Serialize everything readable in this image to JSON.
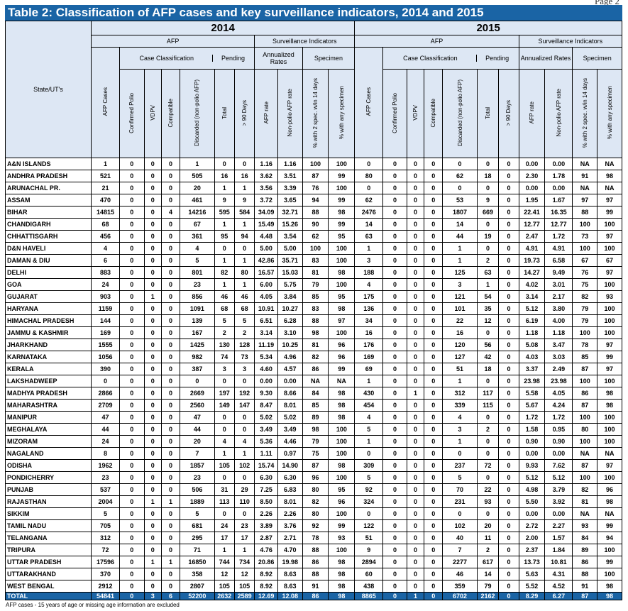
{
  "page_label": "Page 2",
  "title": "Table 2: Classification of AFP cases and key surveillance indicators, 2014 and 2015",
  "headers": {
    "state": "State/UT's",
    "years": [
      "2014",
      "2015"
    ],
    "afp": "AFP",
    "surveillance": "Surveillance Indicators",
    "case_classification": "Case Classification",
    "pending": "Pending",
    "annualized_rates": "Annualized Rates",
    "specimen": "Specimen",
    "afp_cases": "AFP Cases",
    "confirmed_polio": "Confirmed Polio",
    "vdpv": "VDPV",
    "compatible": "Compatible",
    "discarded": "Discarded (non-polio AFP)",
    "total": "Total",
    "days90": "> 90 Days",
    "afp_rate": "AFP rate",
    "non_polio_rate": "Non-polio AFP rate",
    "pct_2spec": "% with 2 spec. w/in 14 days",
    "pct_any": "% with any specimen"
  },
  "rows": [
    [
      "A&N ISLANDS",
      "1",
      "0",
      "0",
      "0",
      "1",
      "0",
      "0",
      "1.16",
      "1.16",
      "100",
      "100",
      "0",
      "0",
      "0",
      "0",
      "0",
      "0",
      "0",
      "0.00",
      "0.00",
      "NA",
      "NA"
    ],
    [
      "ANDHRA PRADESH",
      "521",
      "0",
      "0",
      "0",
      "505",
      "16",
      "16",
      "3.62",
      "3.51",
      "87",
      "99",
      "80",
      "0",
      "0",
      "0",
      "62",
      "18",
      "0",
      "2.30",
      "1.78",
      "91",
      "98"
    ],
    [
      "ARUNACHAL PR.",
      "21",
      "0",
      "0",
      "0",
      "20",
      "1",
      "1",
      "3.56",
      "3.39",
      "76",
      "100",
      "0",
      "0",
      "0",
      "0",
      "0",
      "0",
      "0",
      "0.00",
      "0.00",
      "NA",
      "NA"
    ],
    [
      "ASSAM",
      "470",
      "0",
      "0",
      "0",
      "461",
      "9",
      "9",
      "3.72",
      "3.65",
      "94",
      "99",
      "62",
      "0",
      "0",
      "0",
      "53",
      "9",
      "0",
      "1.95",
      "1.67",
      "97",
      "97"
    ],
    [
      "BIHAR",
      "14815",
      "0",
      "0",
      "4",
      "14216",
      "595",
      "584",
      "34.09",
      "32.71",
      "88",
      "98",
      "2476",
      "0",
      "0",
      "0",
      "1807",
      "669",
      "0",
      "22.41",
      "16.35",
      "88",
      "99"
    ],
    [
      "CHANDIGARH",
      "68",
      "0",
      "0",
      "0",
      "67",
      "1",
      "1",
      "15.49",
      "15.26",
      "90",
      "99",
      "14",
      "0",
      "0",
      "0",
      "14",
      "0",
      "0",
      "12.77",
      "12.77",
      "100",
      "100"
    ],
    [
      "CHHATTISGARH",
      "456",
      "0",
      "0",
      "0",
      "361",
      "95",
      "94",
      "4.48",
      "3.54",
      "62",
      "95",
      "63",
      "0",
      "0",
      "0",
      "44",
      "19",
      "0",
      "2.47",
      "1.72",
      "73",
      "97"
    ],
    [
      "D&N HAVELI",
      "4",
      "0",
      "0",
      "0",
      "4",
      "0",
      "0",
      "5.00",
      "5.00",
      "100",
      "100",
      "1",
      "0",
      "0",
      "0",
      "1",
      "0",
      "0",
      "4.91",
      "4.91",
      "100",
      "100"
    ],
    [
      "DAMAN & DIU",
      "6",
      "0",
      "0",
      "0",
      "5",
      "1",
      "1",
      "42.86",
      "35.71",
      "83",
      "100",
      "3",
      "0",
      "0",
      "0",
      "1",
      "2",
      "0",
      "19.73",
      "6.58",
      "67",
      "67"
    ],
    [
      "DELHI",
      "883",
      "0",
      "0",
      "0",
      "801",
      "82",
      "80",
      "16.57",
      "15.03",
      "81",
      "98",
      "188",
      "0",
      "0",
      "0",
      "125",
      "63",
      "0",
      "14.27",
      "9.49",
      "76",
      "97"
    ],
    [
      "GOA",
      "24",
      "0",
      "0",
      "0",
      "23",
      "1",
      "1",
      "6.00",
      "5.75",
      "79",
      "100",
      "4",
      "0",
      "0",
      "0",
      "3",
      "1",
      "0",
      "4.02",
      "3.01",
      "75",
      "100"
    ],
    [
      "GUJARAT",
      "903",
      "0",
      "1",
      "0",
      "856",
      "46",
      "46",
      "4.05",
      "3.84",
      "85",
      "95",
      "175",
      "0",
      "0",
      "0",
      "121",
      "54",
      "0",
      "3.14",
      "2.17",
      "82",
      "93"
    ],
    [
      "HARYANA",
      "1159",
      "0",
      "0",
      "0",
      "1091",
      "68",
      "68",
      "10.91",
      "10.27",
      "83",
      "98",
      "136",
      "0",
      "0",
      "0",
      "101",
      "35",
      "0",
      "5.12",
      "3.80",
      "79",
      "100"
    ],
    [
      "HIMACHAL PRADESH",
      "144",
      "0",
      "0",
      "0",
      "139",
      "5",
      "5",
      "6.51",
      "6.28",
      "88",
      "97",
      "34",
      "0",
      "0",
      "0",
      "22",
      "12",
      "0",
      "6.19",
      "4.00",
      "79",
      "100"
    ],
    [
      "JAMMU & KASHMIR",
      "169",
      "0",
      "0",
      "0",
      "167",
      "2",
      "2",
      "3.14",
      "3.10",
      "98",
      "100",
      "16",
      "0",
      "0",
      "0",
      "16",
      "0",
      "0",
      "1.18",
      "1.18",
      "100",
      "100"
    ],
    [
      "JHARKHAND",
      "1555",
      "0",
      "0",
      "0",
      "1425",
      "130",
      "128",
      "11.19",
      "10.25",
      "81",
      "96",
      "176",
      "0",
      "0",
      "0",
      "120",
      "56",
      "0",
      "5.08",
      "3.47",
      "78",
      "97"
    ],
    [
      "KARNATAKA",
      "1056",
      "0",
      "0",
      "0",
      "982",
      "74",
      "73",
      "5.34",
      "4.96",
      "82",
      "96",
      "169",
      "0",
      "0",
      "0",
      "127",
      "42",
      "0",
      "4.03",
      "3.03",
      "85",
      "99"
    ],
    [
      "KERALA",
      "390",
      "0",
      "0",
      "0",
      "387",
      "3",
      "3",
      "4.60",
      "4.57",
      "86",
      "99",
      "69",
      "0",
      "0",
      "0",
      "51",
      "18",
      "0",
      "3.37",
      "2.49",
      "87",
      "97"
    ],
    [
      "LAKSHADWEEP",
      "0",
      "0",
      "0",
      "0",
      "0",
      "0",
      "0",
      "0.00",
      "0.00",
      "NA",
      "NA",
      "1",
      "0",
      "0",
      "0",
      "1",
      "0",
      "0",
      "23.98",
      "23.98",
      "100",
      "100"
    ],
    [
      "MADHYA PRADESH",
      "2866",
      "0",
      "0",
      "0",
      "2669",
      "197",
      "192",
      "9.30",
      "8.66",
      "84",
      "98",
      "430",
      "0",
      "1",
      "0",
      "312",
      "117",
      "0",
      "5.58",
      "4.05",
      "86",
      "98"
    ],
    [
      "MAHARASHTRA",
      "2709",
      "0",
      "0",
      "0",
      "2560",
      "149",
      "147",
      "8.47",
      "8.01",
      "85",
      "98",
      "454",
      "0",
      "0",
      "0",
      "339",
      "115",
      "0",
      "5.67",
      "4.24",
      "87",
      "98"
    ],
    [
      "MANIPUR",
      "47",
      "0",
      "0",
      "0",
      "47",
      "0",
      "0",
      "5.02",
      "5.02",
      "89",
      "98",
      "4",
      "0",
      "0",
      "0",
      "4",
      "0",
      "0",
      "1.72",
      "1.72",
      "100",
      "100"
    ],
    [
      "MEGHALAYA",
      "44",
      "0",
      "0",
      "0",
      "44",
      "0",
      "0",
      "3.49",
      "3.49",
      "98",
      "100",
      "5",
      "0",
      "0",
      "0",
      "3",
      "2",
      "0",
      "1.58",
      "0.95",
      "80",
      "100"
    ],
    [
      "MIZORAM",
      "24",
      "0",
      "0",
      "0",
      "20",
      "4",
      "4",
      "5.36",
      "4.46",
      "79",
      "100",
      "1",
      "0",
      "0",
      "0",
      "1",
      "0",
      "0",
      "0.90",
      "0.90",
      "100",
      "100"
    ],
    [
      "NAGALAND",
      "8",
      "0",
      "0",
      "0",
      "7",
      "1",
      "1",
      "1.11",
      "0.97",
      "75",
      "100",
      "0",
      "0",
      "0",
      "0",
      "0",
      "0",
      "0",
      "0.00",
      "0.00",
      "NA",
      "NA"
    ],
    [
      "ODISHA",
      "1962",
      "0",
      "0",
      "0",
      "1857",
      "105",
      "102",
      "15.74",
      "14.90",
      "87",
      "98",
      "309",
      "0",
      "0",
      "0",
      "237",
      "72",
      "0",
      "9.93",
      "7.62",
      "87",
      "97"
    ],
    [
      "PONDICHERRY",
      "23",
      "0",
      "0",
      "0",
      "23",
      "0",
      "0",
      "6.30",
      "6.30",
      "96",
      "100",
      "5",
      "0",
      "0",
      "0",
      "5",
      "0",
      "0",
      "5.12",
      "5.12",
      "100",
      "100"
    ],
    [
      "PUNJAB",
      "537",
      "0",
      "0",
      "0",
      "506",
      "31",
      "29",
      "7.25",
      "6.83",
      "80",
      "95",
      "92",
      "0",
      "0",
      "0",
      "70",
      "22",
      "0",
      "4.98",
      "3.79",
      "82",
      "96"
    ],
    [
      "RAJASTHAN",
      "2004",
      "0",
      "1",
      "1",
      "1889",
      "113",
      "110",
      "8.50",
      "8.01",
      "82",
      "96",
      "324",
      "0",
      "0",
      "0",
      "231",
      "93",
      "0",
      "5.50",
      "3.92",
      "81",
      "98"
    ],
    [
      "SIKKIM",
      "5",
      "0",
      "0",
      "0",
      "5",
      "0",
      "0",
      "2.26",
      "2.26",
      "80",
      "100",
      "0",
      "0",
      "0",
      "0",
      "0",
      "0",
      "0",
      "0.00",
      "0.00",
      "NA",
      "NA"
    ],
    [
      "TAMIL NADU",
      "705",
      "0",
      "0",
      "0",
      "681",
      "24",
      "23",
      "3.89",
      "3.76",
      "92",
      "99",
      "122",
      "0",
      "0",
      "0",
      "102",
      "20",
      "0",
      "2.72",
      "2.27",
      "93",
      "99"
    ],
    [
      "TELANGANA",
      "312",
      "0",
      "0",
      "0",
      "295",
      "17",
      "17",
      "2.87",
      "2.71",
      "78",
      "93",
      "51",
      "0",
      "0",
      "0",
      "40",
      "11",
      "0",
      "2.00",
      "1.57",
      "84",
      "94"
    ],
    [
      "TRIPURA",
      "72",
      "0",
      "0",
      "0",
      "71",
      "1",
      "1",
      "4.76",
      "4.70",
      "88",
      "100",
      "9",
      "0",
      "0",
      "0",
      "7",
      "2",
      "0",
      "2.37",
      "1.84",
      "89",
      "100"
    ],
    [
      "UTTAR PRADESH",
      "17596",
      "0",
      "1",
      "1",
      "16850",
      "744",
      "734",
      "20.86",
      "19.98",
      "86",
      "98",
      "2894",
      "0",
      "0",
      "0",
      "2277",
      "617",
      "0",
      "13.73",
      "10.81",
      "86",
      "99"
    ],
    [
      "UTTARAKHAND",
      "370",
      "0",
      "0",
      "0",
      "358",
      "12",
      "12",
      "8.92",
      "8.63",
      "88",
      "98",
      "60",
      "0",
      "0",
      "0",
      "46",
      "14",
      "0",
      "5.63",
      "4.31",
      "88",
      "100"
    ],
    [
      "WEST BENGAL",
      "2912",
      "0",
      "0",
      "0",
      "2807",
      "105",
      "105",
      "8.92",
      "8.63",
      "91",
      "98",
      "438",
      "0",
      "0",
      "0",
      "359",
      "79",
      "0",
      "5.52",
      "4.52",
      "91",
      "98"
    ]
  ],
  "total_row": [
    "TOTAL",
    "54841",
    "0",
    "3",
    "6",
    "52200",
    "2632",
    "2589",
    "12.69",
    "12.08",
    "86",
    "98",
    "8865",
    "0",
    "1",
    "0",
    "6702",
    "2162",
    "0",
    "8.29",
    "6.27",
    "87",
    "98"
  ],
  "footnote": "AFP cases - 15 years of age or missing age information are excluded",
  "colors": {
    "title_bg": "#1a64a5",
    "header_bg": "#dde7f4",
    "total_bg": "#1a64a5"
  }
}
